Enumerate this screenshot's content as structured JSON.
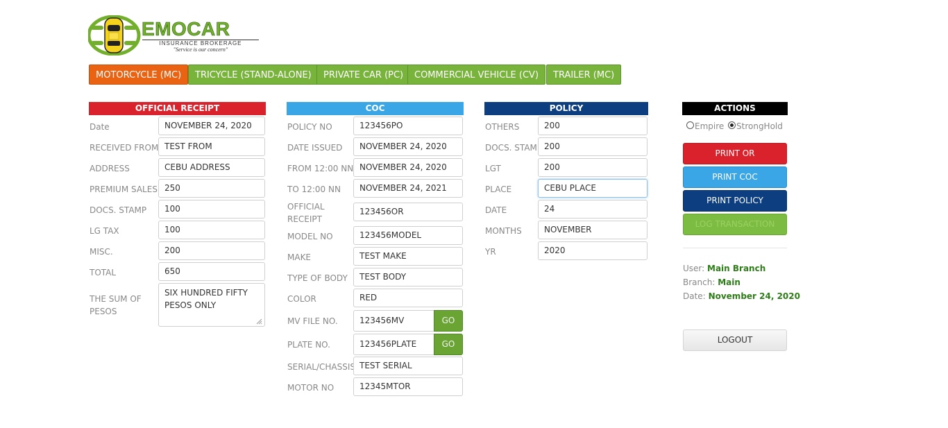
{
  "brand": {
    "name": "EMOCAR",
    "subtitle": "INSURANCE BROKERAGE",
    "tagline": "\"Service is our concern\""
  },
  "tabs": [
    {
      "label": "MOTORCYCLE (MC)",
      "active": true
    },
    {
      "label": "TRICYCLE (STAND-ALONE)",
      "active": false
    },
    {
      "label": "PRIVATE CAR (PC)",
      "active": false
    },
    {
      "label": "COMMERCIAL VEHICLE (CV)",
      "active": false
    },
    {
      "label": "TRAILER (MC)",
      "active": false
    }
  ],
  "official_receipt": {
    "title": "OFFICIAL RECEIPT",
    "fields": [
      {
        "label": "Date",
        "value": "NOVEMBER 24, 2020"
      },
      {
        "label": "RECEIVED FROM",
        "value": "TEST FROM"
      },
      {
        "label": "ADDRESS",
        "value": "CEBU ADDRESS"
      },
      {
        "label": "PREMIUM SALES",
        "value": "250"
      },
      {
        "label": "DOCS. STAMP",
        "value": "100"
      },
      {
        "label": "LG TAX",
        "value": "100"
      },
      {
        "label": "MISC.",
        "value": "200"
      },
      {
        "label": "TOTAL",
        "value": "650"
      },
      {
        "label": "THE SUM OF PESOS",
        "value": "SIX HUNDRED FIFTY PESOS ONLY"
      }
    ]
  },
  "coc": {
    "title": "COC",
    "fields": [
      {
        "label": "POLICY NO",
        "value": "123456PO"
      },
      {
        "label": "DATE ISSUED",
        "value": "NOVEMBER 24, 2020"
      },
      {
        "label": "FROM 12:00 NN",
        "value": "NOVEMBER 24, 2020"
      },
      {
        "label": "TO 12:00 NN",
        "value": "NOVEMBER 24, 2021"
      },
      {
        "label": "OFFICIAL RECEIPT",
        "value": "123456OR"
      },
      {
        "label": "MODEL NO",
        "value": "123456MODEL"
      },
      {
        "label": "MAKE",
        "value": "TEST MAKE"
      },
      {
        "label": "TYPE OF BODY",
        "value": "TEST BODY"
      },
      {
        "label": "COLOR",
        "value": "RED"
      },
      {
        "label": "MV FILE NO.",
        "value": "123456MV",
        "button": "GO"
      },
      {
        "label": "PLATE NO.",
        "value": "123456PLATE",
        "button": "GO"
      },
      {
        "label": "SERIAL/CHASSIS",
        "value": "TEST SERIAL"
      },
      {
        "label": "MOTOR NO",
        "value": "12345MTOR"
      }
    ]
  },
  "policy": {
    "title": "POLICY",
    "fields": [
      {
        "label": "OTHERS",
        "value": "200"
      },
      {
        "label": "DOCS. STAMP",
        "value": "200"
      },
      {
        "label": "LGT",
        "value": "200"
      },
      {
        "label": "PLACE",
        "value": "CEBU PLACE"
      },
      {
        "label": "DATE",
        "value": "24"
      },
      {
        "label": "MONTHS",
        "value": "NOVEMBER"
      },
      {
        "label": "YR",
        "value": "2020"
      }
    ]
  },
  "actions": {
    "title": "ACTIONS",
    "radios": [
      {
        "label": "Empire",
        "checked": false
      },
      {
        "label": "StrongHold",
        "checked": true
      }
    ],
    "buttons": [
      {
        "label": "PRINT OR",
        "color": "#d9222b"
      },
      {
        "label": "PRINT COC",
        "color": "#3aa6e6"
      },
      {
        "label": "PRINT POLICY",
        "color": "#0d3f80"
      },
      {
        "label": "LOG TRANSACTION",
        "color": "#7cbc42"
      }
    ],
    "user_label": "User:",
    "user_value": "Main Branch",
    "branch_label": "Branch:",
    "branch_value": "Main",
    "date_label": "Date:",
    "date_value": "November 24, 2020",
    "logout_label": "LOGOUT"
  },
  "colors": {
    "tab_active": "#ea6312",
    "tab": "#78b33b",
    "official_receipt_header": "#d9222b",
    "coc_header": "#3aa6e6",
    "policy_header": "#0d3f80",
    "actions_header": "#000000"
  }
}
